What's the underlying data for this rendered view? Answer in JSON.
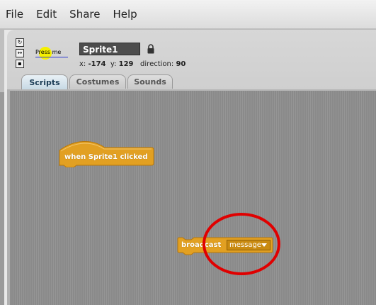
{
  "menu": {
    "items": [
      "File",
      "Edit",
      "Share",
      "Help"
    ]
  },
  "sprite": {
    "thumbnail_text": "Press me",
    "name": "Sprite1",
    "x_label": "x:",
    "x_value": "-174",
    "y_label": "y:",
    "y_value": "129",
    "direction_label": "direction:",
    "direction_value": "90"
  },
  "tabs": [
    {
      "label": "Scripts",
      "active": true
    },
    {
      "label": "Costumes",
      "active": false
    },
    {
      "label": "Sounds",
      "active": false
    }
  ],
  "blocks": {
    "hat_label": "when Sprite1 clicked",
    "broadcast_label": "broadcast",
    "broadcast_value": "message"
  },
  "colors": {
    "block_orange": "#e2a022",
    "highlight_red": "#e00000",
    "sprite_yellow": "#f5f000"
  },
  "icons": [
    "rotate-all-icon",
    "rotate-flip-icon",
    "no-rotate-icon",
    "lock-icon",
    "dropdown-arrow-icon"
  ]
}
